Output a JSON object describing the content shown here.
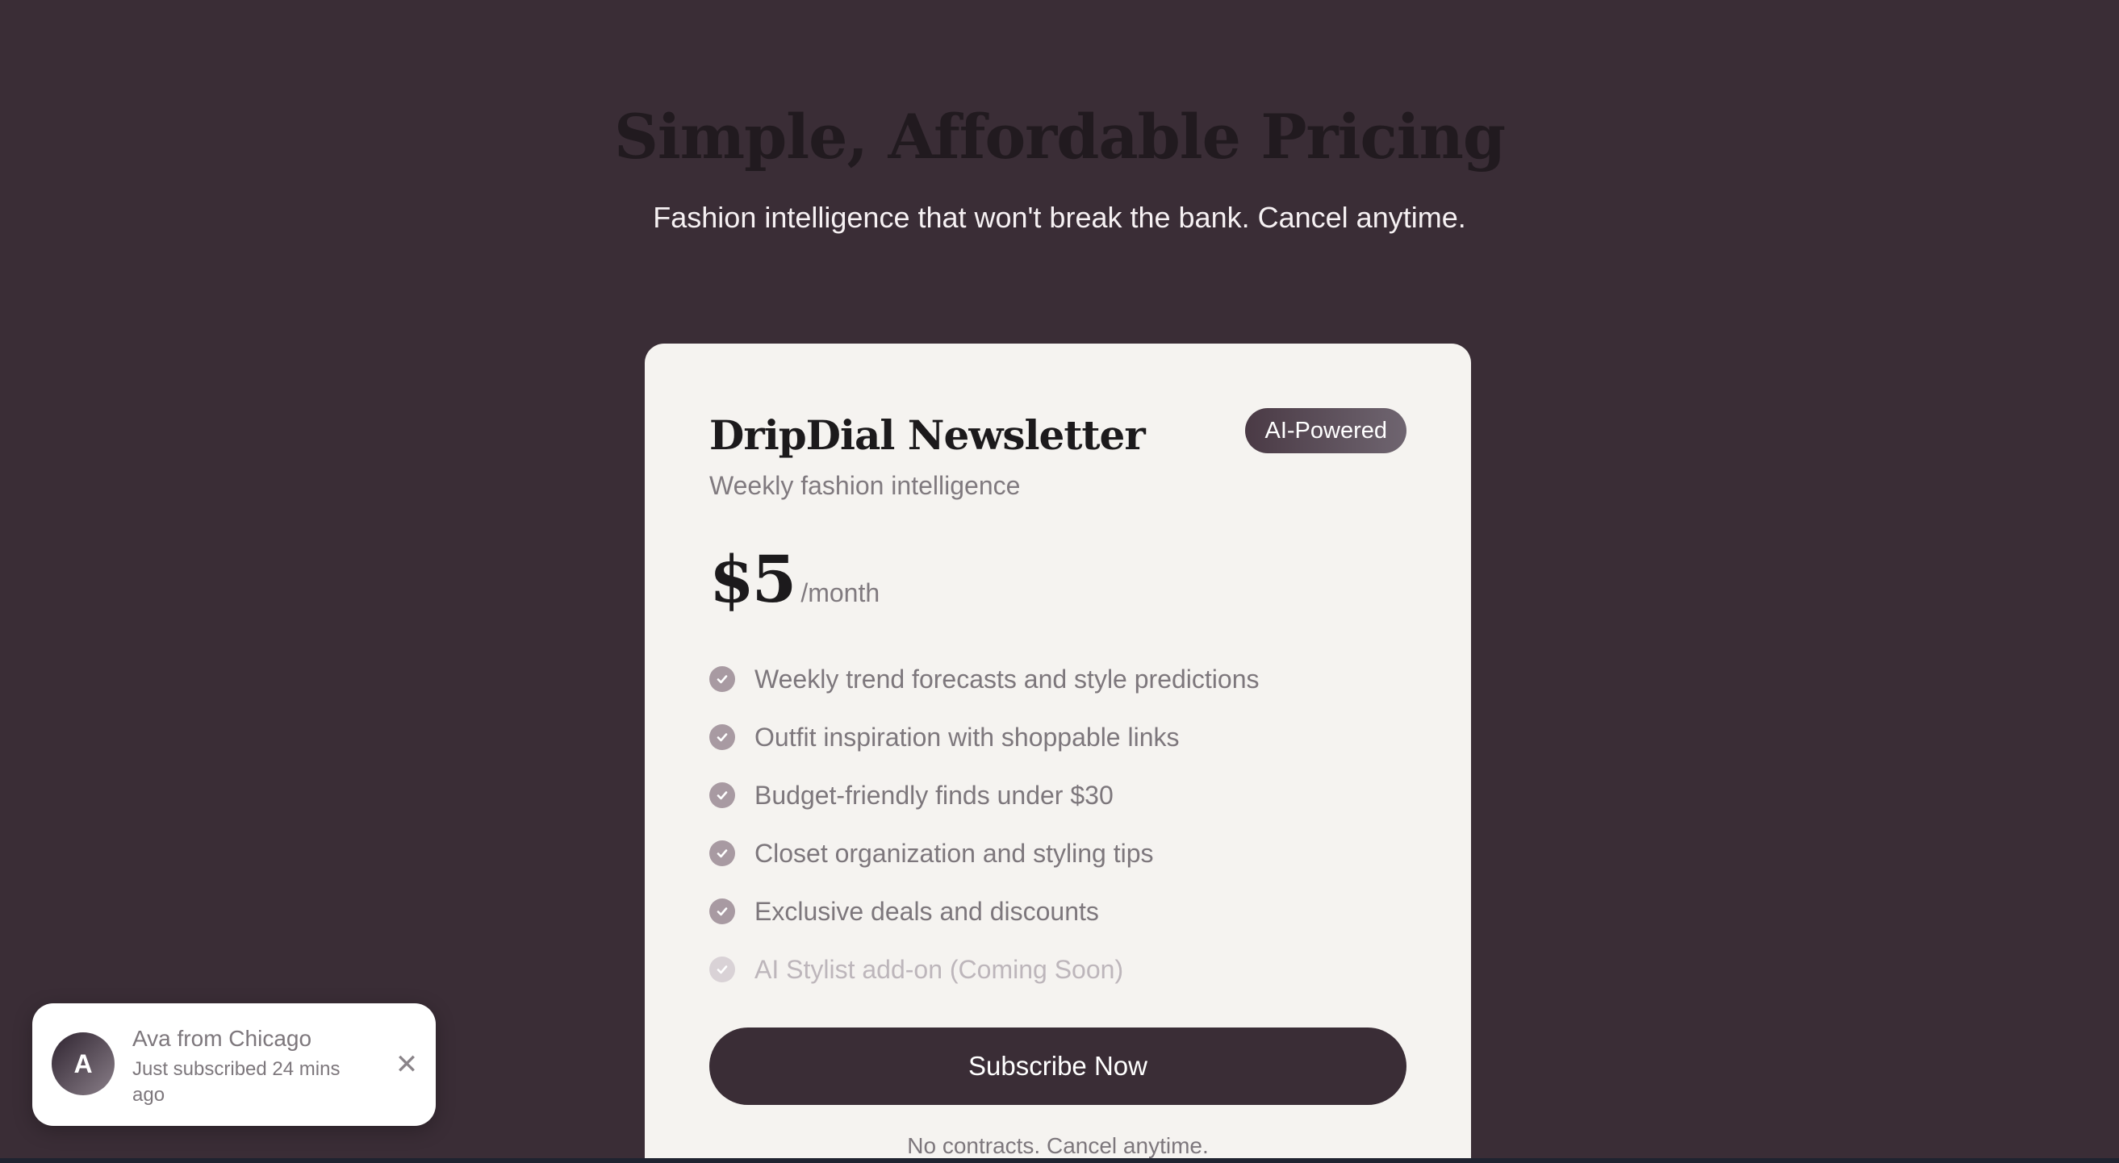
{
  "hero": {
    "title": "Simple, Affordable Pricing",
    "subtitle": "Fashion intelligence that won't break the bank. Cancel anytime."
  },
  "plan": {
    "name": "DripDial Newsletter",
    "badge": "AI-Powered",
    "description": "Weekly fashion intelligence",
    "price": "$5",
    "period": "/month",
    "features": [
      {
        "text": "Weekly trend forecasts and style predictions",
        "icon": "check-circle-icon",
        "available": true
      },
      {
        "text": "Outfit inspiration with shoppable links",
        "icon": "check-circle-icon",
        "available": true
      },
      {
        "text": "Budget-friendly finds under $30",
        "icon": "check-circle-icon",
        "available": true
      },
      {
        "text": "Closet organization and styling tips",
        "icon": "check-circle-icon",
        "available": true
      },
      {
        "text": "Exclusive deals and discounts",
        "icon": "check-circle-icon",
        "available": true
      },
      {
        "text": "AI Stylist add-on (Coming Soon)",
        "icon": "check-circle-icon",
        "available": false
      }
    ],
    "cta_label": "Subscribe Now",
    "fine_print": "No contracts. Cancel anytime."
  },
  "toast": {
    "avatar_initial": "A",
    "name": "Ava from Chicago",
    "message": "Just subscribed 24 mins ago",
    "close_icon": "close-icon",
    "close_glyph": "✕"
  },
  "colors": {
    "background": "#3a2d36",
    "card": "#f5f3f0",
    "button": "#3a2d36",
    "check": "#a89aa2",
    "check_disabled": "#d9d2d6"
  }
}
